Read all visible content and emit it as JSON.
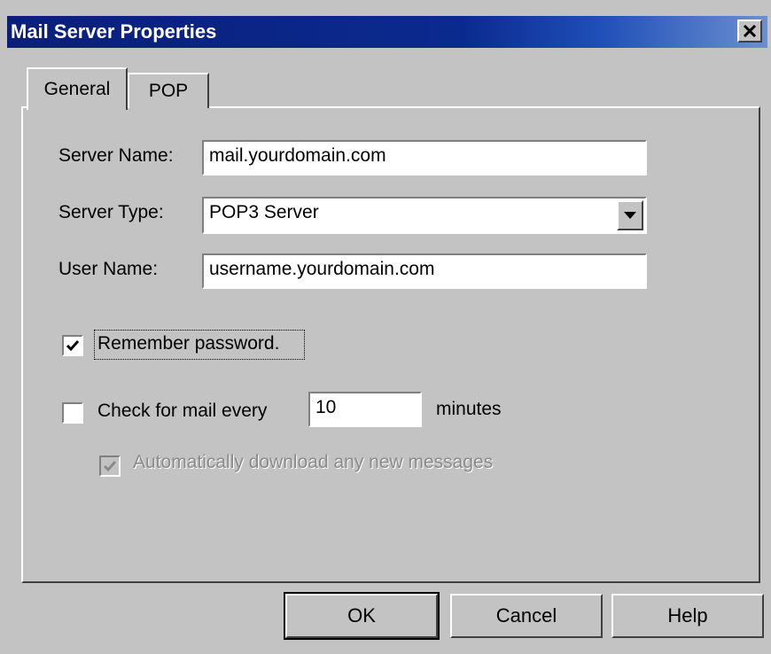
{
  "window": {
    "title": "Mail Server Properties",
    "close_icon": "close-icon"
  },
  "tabs": [
    {
      "label": "General",
      "active": true
    },
    {
      "label": "POP",
      "active": false
    }
  ],
  "form": {
    "server_name": {
      "label": "Server Name:",
      "value": "mail.yourdomain.com"
    },
    "server_type": {
      "label": "Server Type:",
      "value": "POP3 Server"
    },
    "user_name": {
      "label": "User Name:",
      "value": "username.yourdomain.com"
    },
    "remember_password": {
      "label": "Remember password.",
      "checked": true
    },
    "check_mail": {
      "label": "Check for mail every",
      "checked": false,
      "value": "10",
      "suffix": "minutes"
    },
    "auto_download": {
      "label": "Automatically download any new messages",
      "checked": true,
      "disabled": true
    }
  },
  "buttons": {
    "ok": "OK",
    "cancel": "Cancel",
    "help": "Help"
  },
  "colors": {
    "title_bar": "#0b2a8f",
    "face": "#c3c3c3"
  }
}
